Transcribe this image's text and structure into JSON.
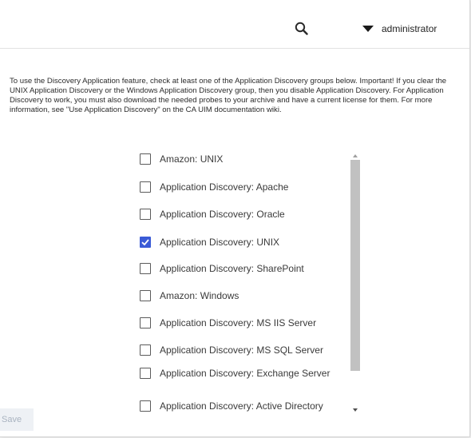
{
  "header": {
    "user": "administrator"
  },
  "intro_text": "To use the Discovery Application feature, check at least one of the Application Discovery groups below. Important! If you clear the UNIX Application Discovery or the Windows Application Discovery group, then you disable Application Discovery. For Application Discovery to work, you must also download the needed probes to your archive and have a current license for them. For more information, see \"Use Application Discovery\" on the CA UIM documentation wiki.",
  "groups": [
    {
      "label": "Amazon: UNIX",
      "checked": false
    },
    {
      "label": "Application Discovery: Apache",
      "checked": false
    },
    {
      "label": "Application Discovery: Oracle",
      "checked": false
    },
    {
      "label": "Application Discovery: UNIX",
      "checked": true
    },
    {
      "label": "Application Discovery: SharePoint",
      "checked": false
    },
    {
      "label": "Amazon: Windows",
      "checked": false
    },
    {
      "label": "Application Discovery: MS IIS Server",
      "checked": false
    },
    {
      "label": "Application Discovery: MS SQL Server",
      "checked": false
    },
    {
      "label": "Application Discovery: Exchange Server",
      "checked": false
    },
    {
      "label": "Application Discovery: Active Directory",
      "checked": false
    }
  ],
  "save_label": "Save",
  "colors": {
    "checkbox_checked": "#3b5bd6",
    "save_disabled_text": "#a9b3c0",
    "scroll_thumb": "#c1c1c1"
  }
}
